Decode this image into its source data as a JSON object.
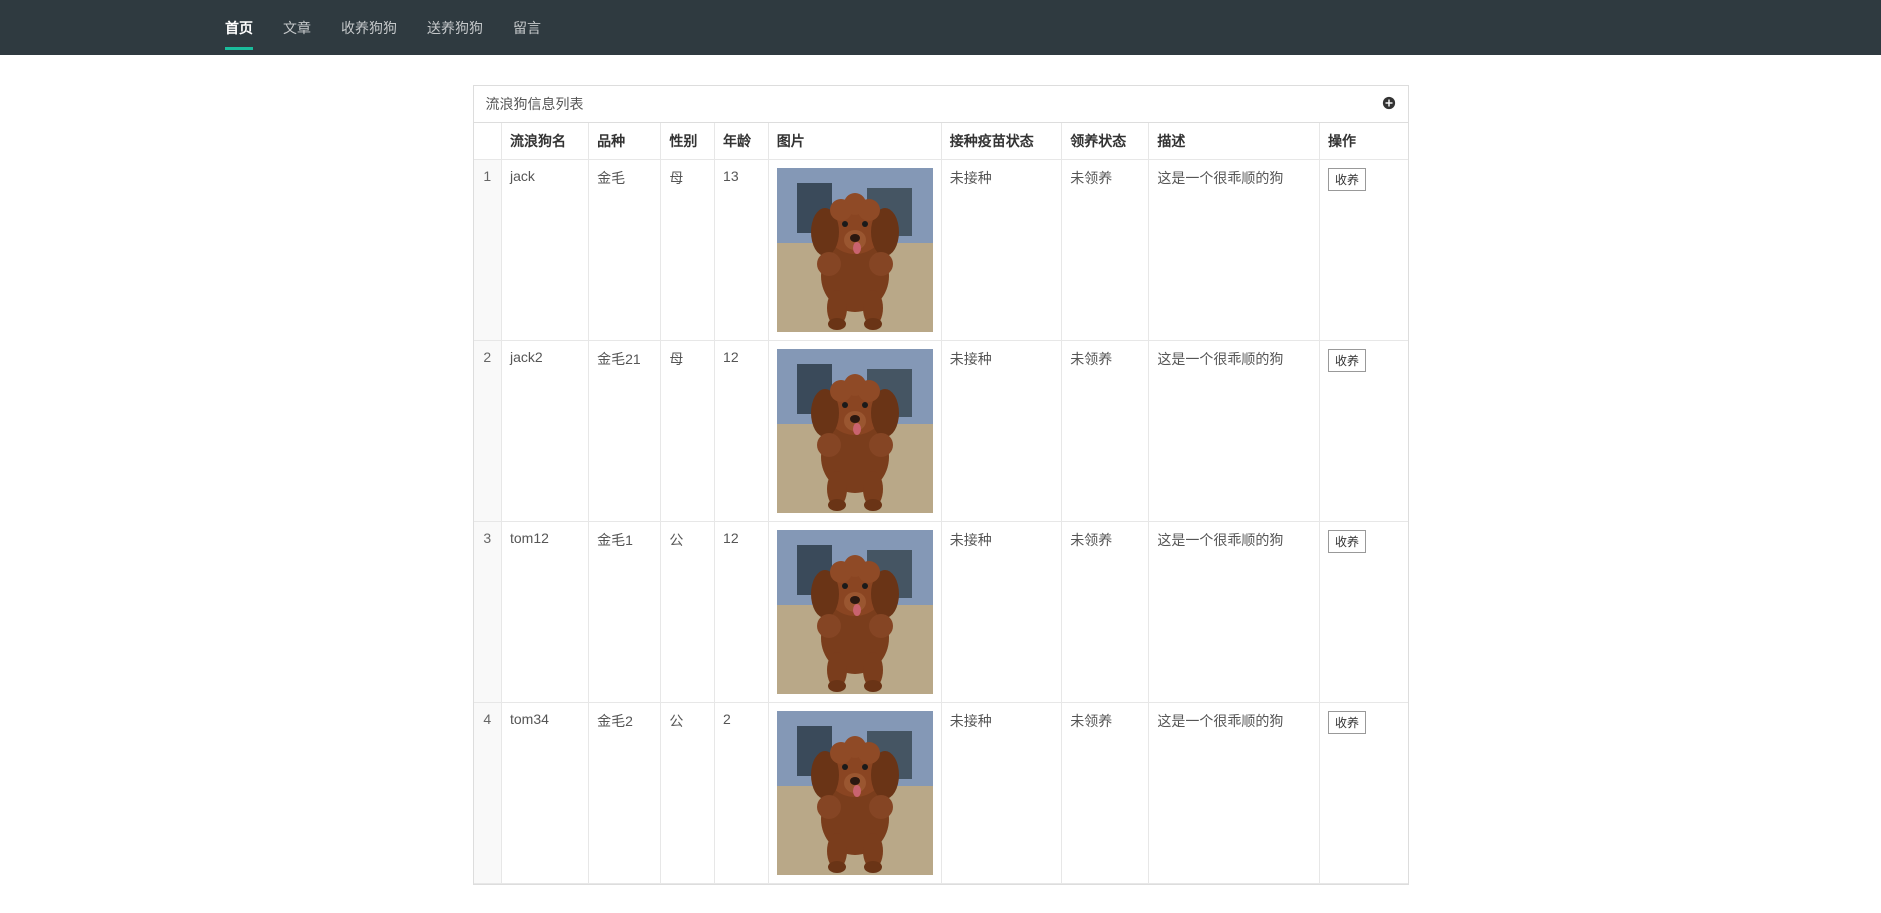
{
  "nav": {
    "items": [
      {
        "label": "首页",
        "active": true
      },
      {
        "label": "文章",
        "active": false
      },
      {
        "label": "收养狗狗",
        "active": false
      },
      {
        "label": "送养狗狗",
        "active": false
      },
      {
        "label": "留言",
        "active": false
      }
    ]
  },
  "panel": {
    "title": "流浪狗信息列表"
  },
  "table": {
    "headers": {
      "idx": "",
      "name": "流浪狗名",
      "breed": "品种",
      "gender": "性别",
      "age": "年龄",
      "image": "图片",
      "vaccine": "接种疫苗状态",
      "adopt": "领养状态",
      "desc": "描述",
      "op": "操作"
    },
    "action_label": "收养",
    "rows": [
      {
        "idx": "1",
        "name": "jack",
        "breed": "金毛",
        "gender": "母",
        "age": "13",
        "vaccine": "未接种",
        "adopt": "未领养",
        "desc": "这是一个很乖顺的狗"
      },
      {
        "idx": "2",
        "name": "jack2",
        "breed": "金毛21",
        "gender": "母",
        "age": "12",
        "vaccine": "未接种",
        "adopt": "未领养",
        "desc": "这是一个很乖顺的狗"
      },
      {
        "idx": "3",
        "name": "tom12",
        "breed": "金毛1",
        "gender": "公",
        "age": "12",
        "vaccine": "未接种",
        "adopt": "未领养",
        "desc": "这是一个很乖顺的狗"
      },
      {
        "idx": "4",
        "name": "tom34",
        "breed": "金毛2",
        "gender": "公",
        "age": "2",
        "vaccine": "未接种",
        "adopt": "未领养",
        "desc": "这是一个很乖顺的狗"
      }
    ]
  }
}
